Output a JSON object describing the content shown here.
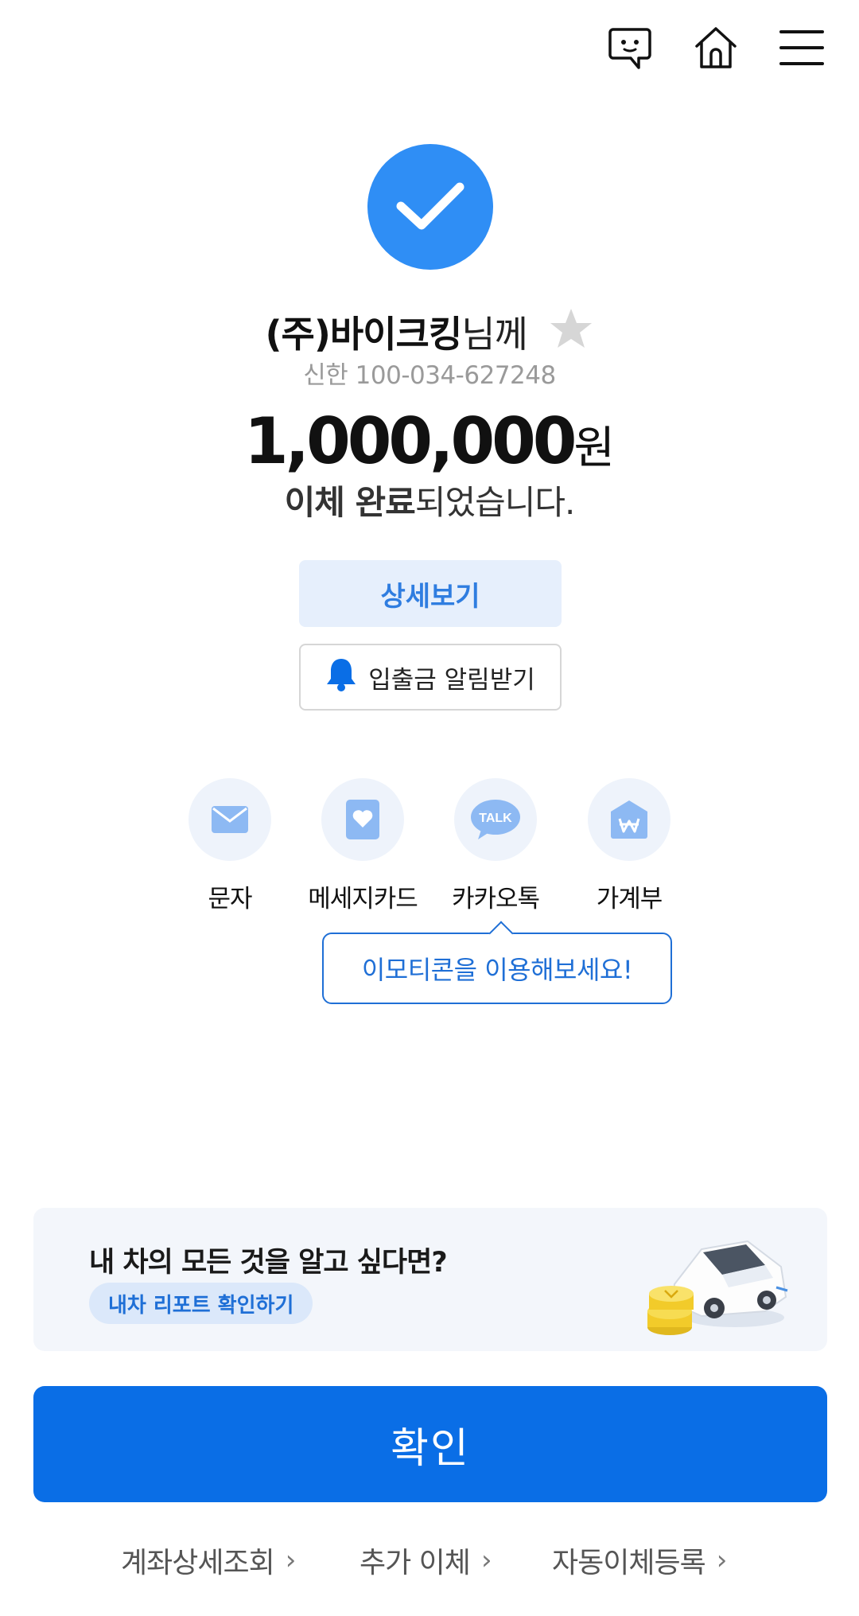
{
  "header": {
    "icons": [
      "chat-icon",
      "home-icon",
      "menu-icon"
    ]
  },
  "result": {
    "recipient_name": "(주)바이크킹",
    "recipient_suffix": "님께",
    "account": "신한 100-034-627248",
    "amount": "1,000,000",
    "amount_unit": "원",
    "done_bold": "이체 완료",
    "done_rest": "되었습니다."
  },
  "actions": {
    "detail_label": "상세보기",
    "alert_label": "입출금 알림받기"
  },
  "share": {
    "items": [
      {
        "label": "문자",
        "icon": "mail-icon"
      },
      {
        "label": "메세지카드",
        "icon": "message-card-icon"
      },
      {
        "label": "카카오톡",
        "icon": "kakaotalk-icon"
      },
      {
        "label": "가계부",
        "icon": "household-ledger-icon"
      }
    ],
    "tooltip": "이모티콘을 이용해보세요!",
    "talk_badge": "TALK"
  },
  "banner": {
    "title": "내 차의 모든 것을 알고 싶다면?",
    "link_label": "내차 리포트 확인하기"
  },
  "confirm_label": "확인",
  "bottom_links": [
    {
      "label": "계좌상세조회"
    },
    {
      "label": "추가 이체"
    },
    {
      "label": "자동이체등록"
    }
  ],
  "colors": {
    "primary": "#0a6ee6",
    "check": "#2f8ef5",
    "tint": "#e6effc"
  }
}
